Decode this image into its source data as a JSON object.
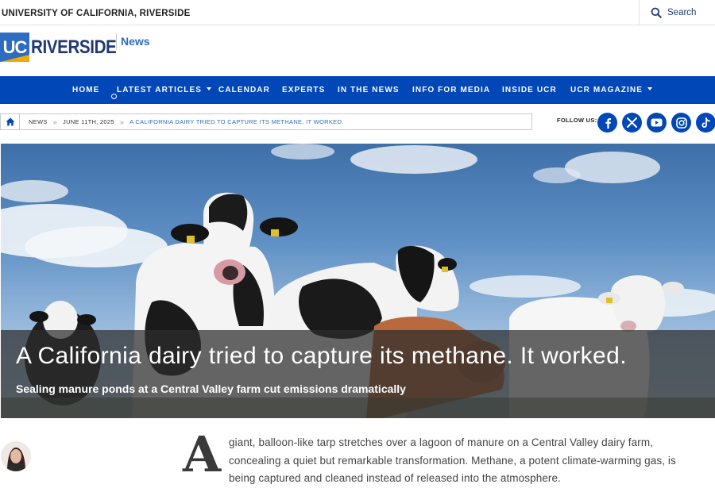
{
  "topbar": {
    "university": "UNIVERSITY OF CALIFORNIA, RIVERSIDE",
    "search_label": "Search"
  },
  "logo": {
    "uc": "UC",
    "riverside": "RIVERSIDE",
    "section": "News"
  },
  "nav": {
    "items": [
      {
        "label": "HOME",
        "dropdown": false
      },
      {
        "label": "LATEST ARTICLES",
        "dropdown": true
      },
      {
        "label": "CALENDAR",
        "dropdown": false
      },
      {
        "label": "EXPERTS",
        "dropdown": false
      },
      {
        "label": "IN THE NEWS",
        "dropdown": false
      },
      {
        "label": "INFO FOR MEDIA",
        "dropdown": false
      },
      {
        "label": "INSIDE UCR",
        "dropdown": false
      },
      {
        "label": "UCR MAGAZINE",
        "dropdown": true
      }
    ]
  },
  "breadcrumb": {
    "items": [
      "NEWS",
      "JUNE 11TH, 2025",
      "A CALIFORNIA DAIRY TRIED TO CAPTURE ITS METHANE. IT WORKED."
    ],
    "separator": "»"
  },
  "social": {
    "label": "FOLLOW US:",
    "icons": [
      "facebook-icon",
      "x-icon",
      "youtube-icon",
      "instagram-icon",
      "tiktok-icon"
    ],
    "color": "#0147b7"
  },
  "hero": {
    "title": "A California dairy tried to capture its methane. It worked.",
    "subtitle": "Sealing manure ponds at a Central Valley farm cut emissions dramatically"
  },
  "article": {
    "dropcap": "A",
    "lines": [
      "giant, balloon-like tarp stretches over a lagoon of manure on a Central Valley dairy farm,",
      "concealing a quiet but remarkable transformation. Methane, a potent climate-warming gas, is",
      "being captured and cleaned instead of released into the atmosphere."
    ]
  },
  "colors": {
    "nav_blue": "#0147b7",
    "brand_navy": "#1f3a72",
    "brand_blue": "#2d6cc0",
    "brand_gold": "#f1ab00"
  }
}
